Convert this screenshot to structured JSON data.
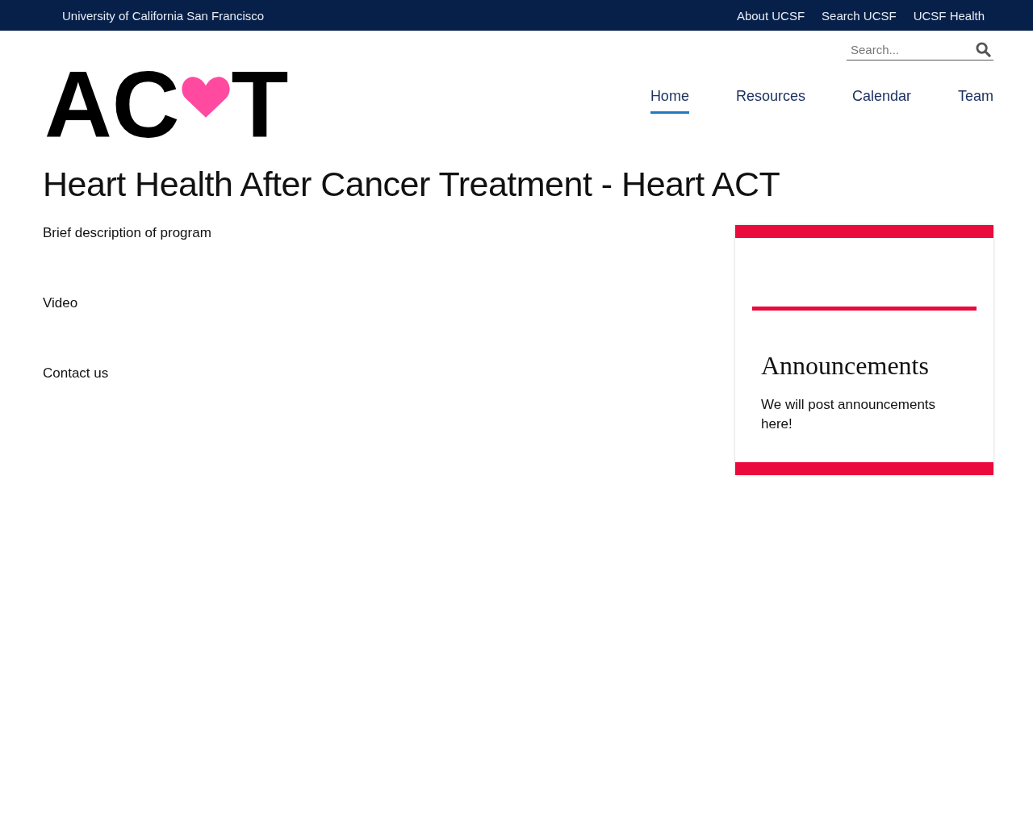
{
  "top_bar": {
    "institution": "University of California San Francisco",
    "links": [
      "About UCSF",
      "Search UCSF",
      "UCSF Health"
    ]
  },
  "search": {
    "placeholder": "Search..."
  },
  "logo": {
    "parts": [
      "AC",
      "T"
    ]
  },
  "nav": [
    {
      "label": "Home",
      "selected": true
    },
    {
      "label": "Resources",
      "selected": false
    },
    {
      "label": "Calendar",
      "selected": false
    },
    {
      "label": "Team",
      "selected": false
    }
  ],
  "page_title": "Heart Health After Cancer Treatment - Heart ACT",
  "sections": [
    "Brief description of program",
    "Video",
    "Contact us"
  ],
  "announcements": {
    "title": "Announcements",
    "text": "We will post announcements here!"
  }
}
